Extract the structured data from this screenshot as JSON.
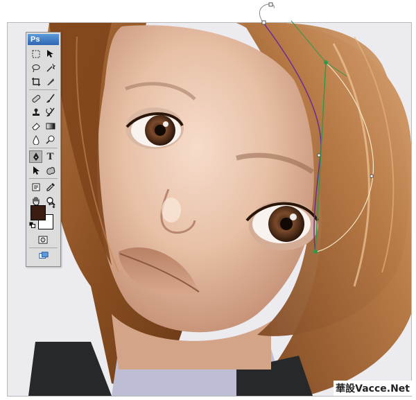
{
  "app": {
    "logo": "Ps",
    "foreground_color": "#3a1d10",
    "background_color": "#ffffff"
  },
  "tools": [
    {
      "name": "marquee-tool-icon"
    },
    {
      "name": "move-tool-icon"
    },
    {
      "name": "lasso-tool-icon"
    },
    {
      "name": "magic-wand-tool-icon"
    },
    {
      "name": "crop-tool-icon"
    },
    {
      "name": "slice-tool-icon"
    },
    {
      "name": "healing-brush-tool-icon"
    },
    {
      "name": "brush-tool-icon"
    },
    {
      "name": "clone-stamp-tool-icon"
    },
    {
      "name": "history-brush-tool-icon"
    },
    {
      "name": "eraser-tool-icon"
    },
    {
      "name": "gradient-tool-icon"
    },
    {
      "name": "blur-tool-icon"
    },
    {
      "name": "dodge-tool-icon"
    },
    {
      "name": "pen-tool-icon"
    },
    {
      "name": "type-tool-icon"
    },
    {
      "name": "path-selection-tool-icon"
    },
    {
      "name": "custom-shape-tool-icon"
    },
    {
      "name": "notes-tool-icon"
    },
    {
      "name": "eyedropper-tool-icon"
    },
    {
      "name": "hand-tool-icon"
    },
    {
      "name": "zoom-tool-icon"
    }
  ],
  "type_tool_glyph": "T",
  "watermark": "華設Vacce.Net"
}
